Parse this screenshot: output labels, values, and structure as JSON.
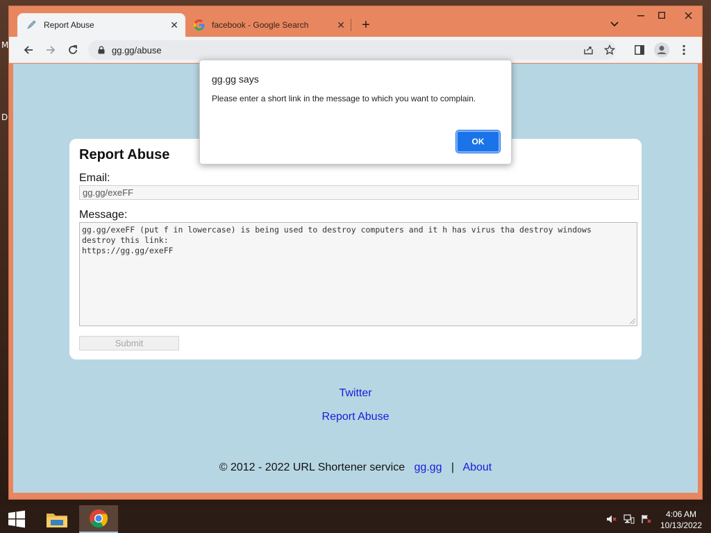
{
  "desktop": {
    "side_letters": [
      "M",
      "D"
    ]
  },
  "browser": {
    "tabs": [
      {
        "title": "Report Abuse",
        "icon": "pen-favicon-icon",
        "active": true
      },
      {
        "title": "facebook - Google Search",
        "icon": "google-favicon-icon",
        "active": false
      }
    ],
    "new_tab_symbol": "+",
    "url": "gg.gg/abuse"
  },
  "page": {
    "heading": "Report Abuse",
    "email_label": "Email:",
    "email_value": "gg.gg/exeFF",
    "message_label": "Message:",
    "message_value": "gg.gg/exeFF (put f in lowercase) is being used to destroy computers and it h has virus tha destroy windows\ndestroy this link:\nhttps://gg.gg/exeFF",
    "submit_label": "Submit",
    "links": {
      "twitter": "Twitter",
      "report_abuse": "Report Abuse"
    },
    "footer": {
      "copyright": "© 2012 - 2022 URL Shortener service",
      "site_link": "gg.gg",
      "separator": "|",
      "about_link": "About"
    }
  },
  "dialog": {
    "title": "gg.gg says",
    "message": "Please enter a short link in the message to which you want to complain.",
    "ok_label": "OK"
  },
  "taskbar": {
    "time": "4:06 AM",
    "date": "10/13/2022"
  },
  "colors": {
    "browser_frame": "#e8875f",
    "page_background": "#b7d6e3",
    "link": "#1a1adb",
    "dialog_button": "#1a73e8",
    "taskbar": "#2b1d16"
  }
}
